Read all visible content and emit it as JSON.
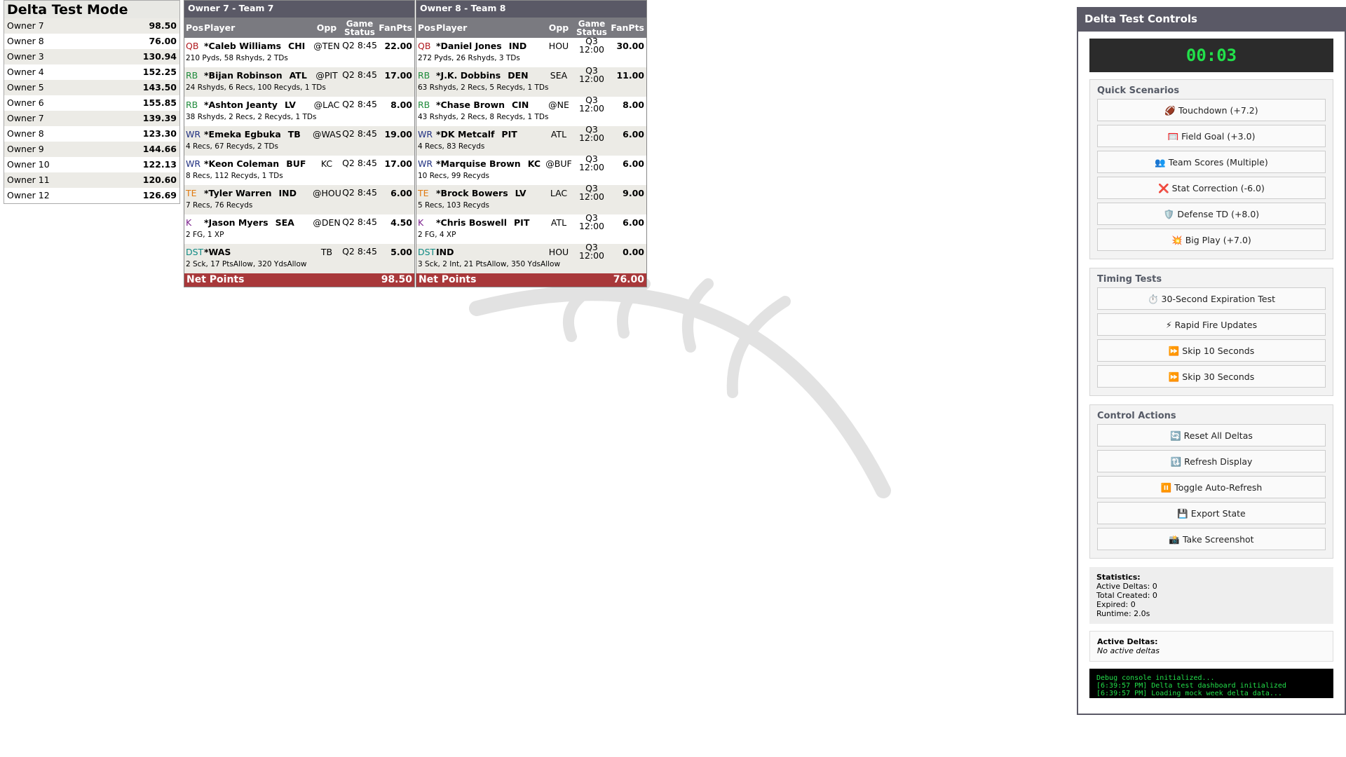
{
  "standings": {
    "title": "Delta Test Mode",
    "rows": [
      {
        "owner": "Owner 7",
        "score": "98.50"
      },
      {
        "owner": "Owner 8",
        "score": "76.00"
      },
      {
        "owner": "Owner 3",
        "score": "130.94"
      },
      {
        "owner": "Owner 4",
        "score": "152.25"
      },
      {
        "owner": "Owner 5",
        "score": "143.50"
      },
      {
        "owner": "Owner 6",
        "score": "155.85"
      },
      {
        "owner": "Owner 7",
        "score": "139.39"
      },
      {
        "owner": "Owner 8",
        "score": "123.30"
      },
      {
        "owner": "Owner 9",
        "score": "144.66"
      },
      {
        "owner": "Owner 10",
        "score": "122.13"
      },
      {
        "owner": "Owner 11",
        "score": "120.60"
      },
      {
        "owner": "Owner 12",
        "score": "126.69"
      }
    ]
  },
  "headers": {
    "pos": "Pos",
    "player": "Player",
    "opp": "Opp",
    "game_status": "Game Status",
    "pts": "FanPts"
  },
  "teams": [
    {
      "title": "Owner 7 - Team 7",
      "net_label": "Net Points",
      "net": "98.50",
      "players": [
        {
          "pos": "QB",
          "name": "*Caleb Williams",
          "nfl": "CHI",
          "opp": "@TEN",
          "status": "Q2 8:45",
          "pts": "22.00",
          "stats": "210 Pyds, 58 Rshyds, 2 TDs"
        },
        {
          "pos": "RB",
          "name": "*Bijan Robinson",
          "nfl": "ATL",
          "opp": "@PIT",
          "status": "Q2 8:45",
          "pts": "17.00",
          "stats": "24 Rshyds, 6 Recs, 100 Recyds, 1 TDs"
        },
        {
          "pos": "RB",
          "name": "*Ashton Jeanty",
          "nfl": "LV",
          "opp": "@LAC",
          "status": "Q2 8:45",
          "pts": "8.00",
          "stats": "38 Rshyds, 2 Recs, 2 Recyds, 1 TDs"
        },
        {
          "pos": "WR",
          "name": "*Emeka Egbuka",
          "nfl": "TB",
          "opp": "@WAS",
          "status": "Q2 8:45",
          "pts": "19.00",
          "stats": "4 Recs, 67 Recyds, 2 TDs"
        },
        {
          "pos": "WR",
          "name": "*Keon Coleman",
          "nfl": "BUF",
          "opp": "KC",
          "status": "Q2 8:45",
          "pts": "17.00",
          "stats": "8 Recs, 112 Recyds, 1 TDs"
        },
        {
          "pos": "TE",
          "name": "*Tyler Warren",
          "nfl": "IND",
          "opp": "@HOU",
          "status": "Q2 8:45",
          "pts": "6.00",
          "stats": "7 Recs, 76 Recyds"
        },
        {
          "pos": "K",
          "name": "*Jason Myers",
          "nfl": "SEA",
          "opp": "@DEN",
          "status": "Q2 8:45",
          "pts": "4.50",
          "stats": "2 FG, 1 XP"
        },
        {
          "pos": "DST",
          "name": "*WAS",
          "nfl": "",
          "opp": "TB",
          "status": "Q2 8:45",
          "pts": "5.00",
          "stats": "2 Sck, 17 PtsAllow, 320 YdsAllow"
        }
      ]
    },
    {
      "title": "Owner 8 - Team 8",
      "net_label": "Net Points",
      "net": "76.00",
      "players": [
        {
          "pos": "QB",
          "name": "*Daniel Jones",
          "nfl": "IND",
          "opp": "HOU",
          "status": "Q3 12:00",
          "pts": "30.00",
          "stats": "272 Pyds, 26 Rshyds, 3 TDs"
        },
        {
          "pos": "RB",
          "name": "*J.K. Dobbins",
          "nfl": "DEN",
          "opp": "SEA",
          "status": "Q3 12:00",
          "pts": "11.00",
          "stats": "63 Rshyds, 2 Recs, 5 Recyds, 1 TDs"
        },
        {
          "pos": "RB",
          "name": "*Chase Brown",
          "nfl": "CIN",
          "opp": "@NE",
          "status": "Q3 12:00",
          "pts": "8.00",
          "stats": "43 Rshyds, 2 Recs, 8 Recyds, 1 TDs"
        },
        {
          "pos": "WR",
          "name": "*DK Metcalf",
          "nfl": "PIT",
          "opp": "ATL",
          "status": "Q3 12:00",
          "pts": "6.00",
          "stats": "4 Recs, 83 Recyds"
        },
        {
          "pos": "WR",
          "name": "*Marquise Brown",
          "nfl": "KC",
          "opp": "@BUF",
          "status": "Q3 12:00",
          "pts": "6.00",
          "stats": "10 Recs, 99 Recyds"
        },
        {
          "pos": "TE",
          "name": "*Brock Bowers",
          "nfl": "LV",
          "opp": "LAC",
          "status": "Q3 12:00",
          "pts": "9.00",
          "stats": "5 Recs, 103 Recyds"
        },
        {
          "pos": "K",
          "name": "*Chris Boswell",
          "nfl": "PIT",
          "opp": "ATL",
          "status": "Q3 12:00",
          "pts": "6.00",
          "stats": "2 FG, 4 XP"
        },
        {
          "pos": "DST",
          "name": "IND",
          "nfl": "",
          "opp": "HOU",
          "status": "Q3 12:00",
          "pts": "0.00",
          "stats": "3 Sck, 2 Int, 21 PtsAllow, 350 YdsAllow"
        }
      ]
    }
  ],
  "controls": {
    "title": "Delta Test Controls",
    "timer": "00:03",
    "quick": {
      "title": "Quick Scenarios",
      "buttons": [
        "🏈 Touchdown (+7.2)",
        "🥅 Field Goal (+3.0)",
        "👥 Team Scores (Multiple)",
        "❌ Stat Correction (-6.0)",
        "🛡️ Defense TD (+8.0)",
        "💥 Big Play (+7.0)"
      ]
    },
    "timing": {
      "title": "Timing Tests",
      "buttons": [
        "⏱️ 30-Second Expiration Test",
        "⚡ Rapid Fire Updates",
        "⏩ Skip 10 Seconds",
        "⏩ Skip 30 Seconds"
      ]
    },
    "actions": {
      "title": "Control Actions",
      "buttons": [
        "🔄 Reset All Deltas",
        "🔃 Refresh Display",
        "⏸️ Toggle Auto-Refresh",
        "💾 Export State",
        "📸 Take Screenshot"
      ]
    },
    "statistics": {
      "title": "Statistics:",
      "active": "Active Deltas: 0",
      "created": "Total Created: 0",
      "expired": "Expired: 0",
      "runtime": "Runtime: 2.0s"
    },
    "active_deltas": {
      "title": "Active Deltas:",
      "empty": "No active deltas"
    },
    "console": [
      "Debug console initialized...",
      "[6:39:57 PM] Delta test dashboard initialized",
      "[6:39:57 PM] Loading mock week delta data..."
    ]
  }
}
